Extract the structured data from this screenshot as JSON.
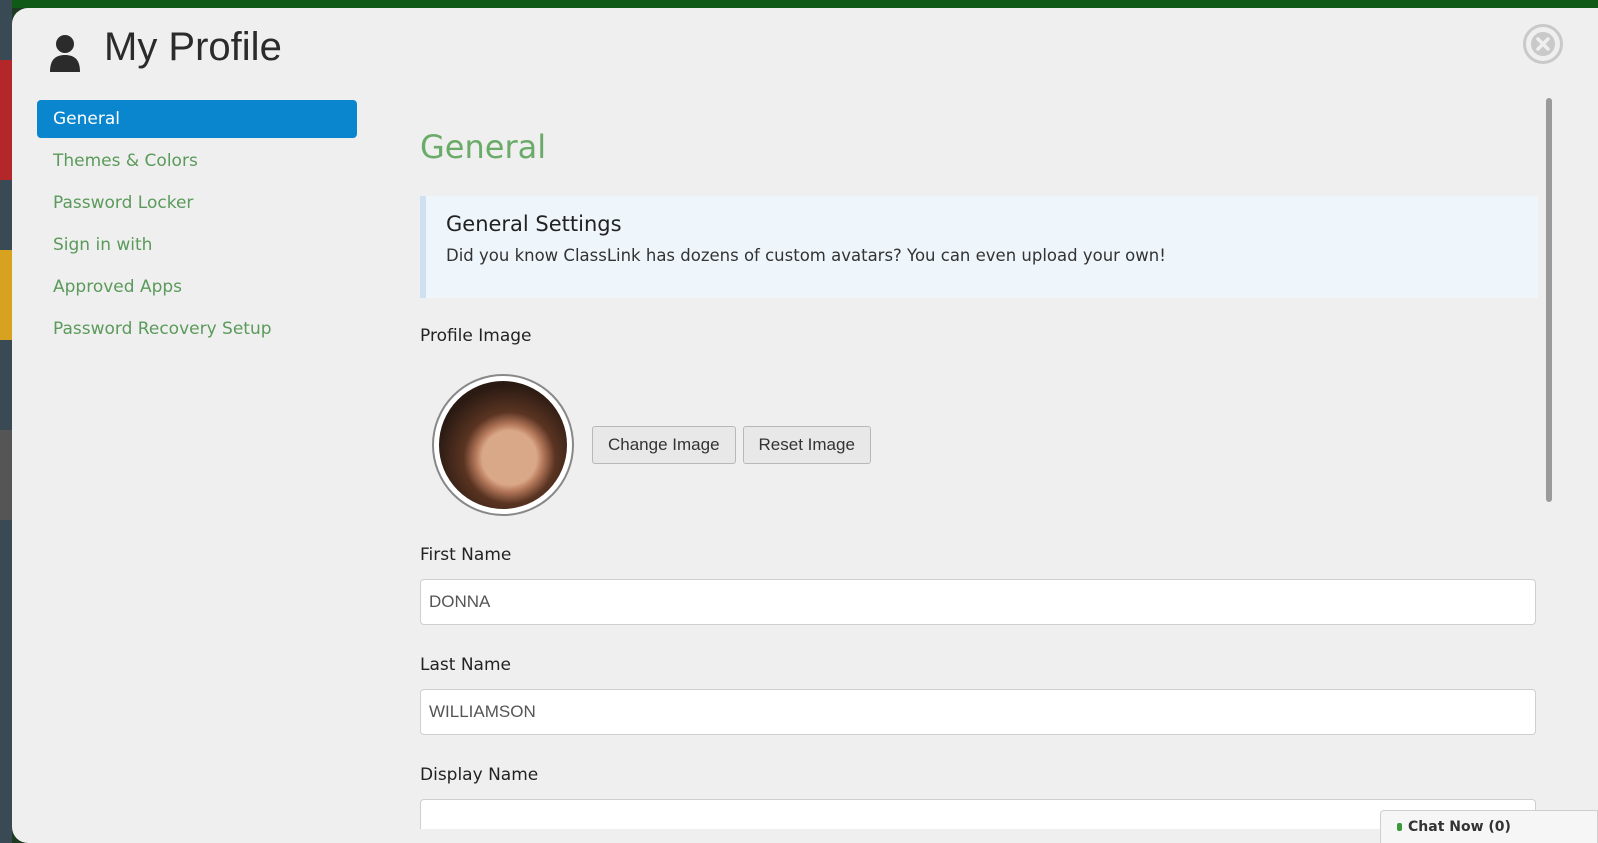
{
  "window": {
    "title": "My Profile"
  },
  "icons": {
    "user": "user-icon",
    "close": "close-icon",
    "chat": "chat-icon"
  },
  "colors": {
    "accent": "#0a86cf",
    "link_green": "#5a9a5a",
    "section_green": "#6aab6a"
  },
  "sidebar": {
    "items": [
      {
        "label": "General",
        "active": true
      },
      {
        "label": "Themes & Colors",
        "active": false
      },
      {
        "label": "Password Locker",
        "active": false
      },
      {
        "label": "Sign in with",
        "active": false
      },
      {
        "label": "Approved Apps",
        "active": false
      },
      {
        "label": "Password Recovery Setup",
        "active": false
      }
    ]
  },
  "main": {
    "section_title": "General",
    "info": {
      "title": "General Settings",
      "text": "Did you know ClassLink has dozens of custom avatars? You can even upload your own!"
    },
    "profile_image": {
      "label": "Profile Image",
      "change_label": "Change Image",
      "reset_label": "Reset Image"
    },
    "first_name": {
      "label": "First Name",
      "value": "DONNA"
    },
    "last_name": {
      "label": "Last Name",
      "value": "WILLIAMSON"
    },
    "display_name": {
      "label": "Display Name"
    }
  },
  "chat": {
    "label": "Chat Now (0)"
  }
}
